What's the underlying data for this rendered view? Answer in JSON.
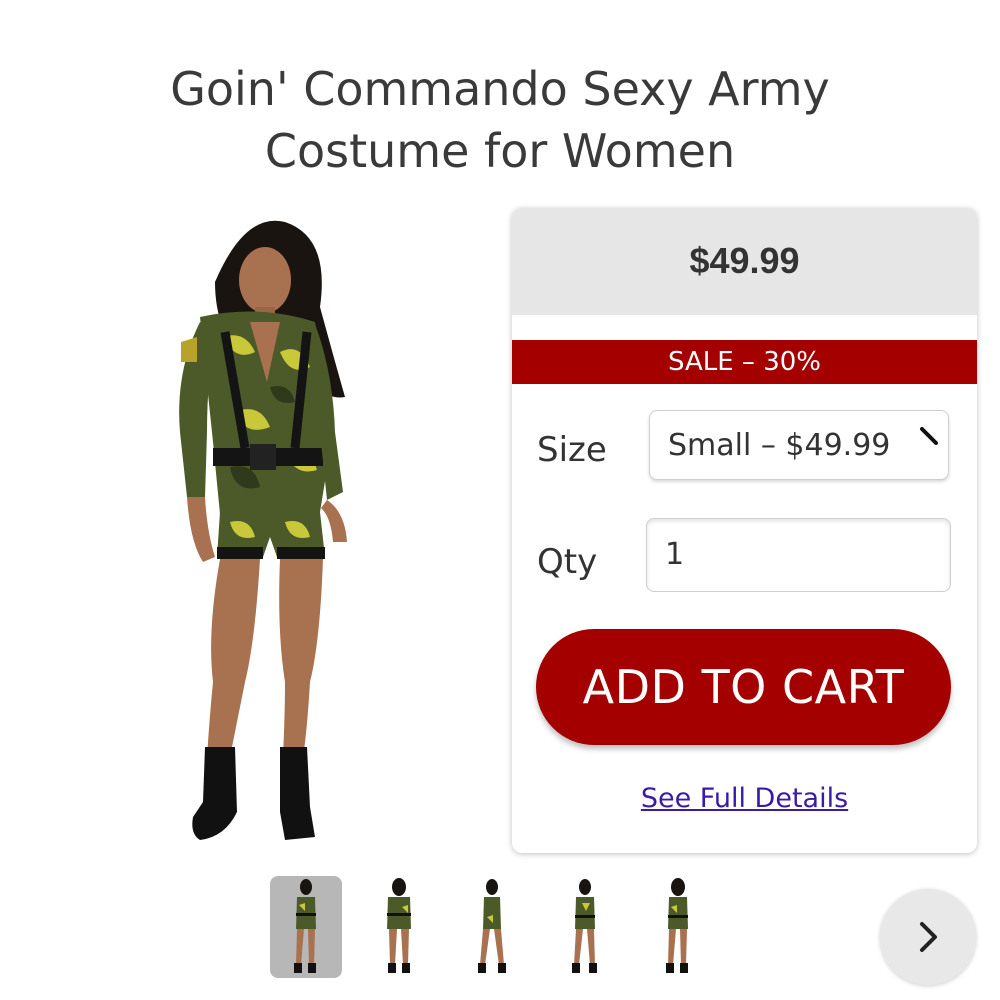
{
  "product": {
    "title_line1": "Goin' Commando Sexy Army",
    "title_line2": "Costume for Women"
  },
  "purchase": {
    "price": "$49.99",
    "sale_label": "SALE – 30%",
    "size_label": "Size",
    "size_selected": "Small – $49.99",
    "qty_label": "Qty",
    "qty_value": "1",
    "add_to_cart_label": "ADD TO CART",
    "details_link": "See Full Details"
  },
  "gallery": {
    "thumbnail_count": 5,
    "active_index": 0,
    "next_icon": "chevron-right-icon"
  },
  "colors": {
    "accent": "#a50000",
    "price_bar": "#e6e6e6",
    "link": "#3b1aa8",
    "camo_dark": "#2f3a1c",
    "camo_light": "#c8c83a"
  }
}
